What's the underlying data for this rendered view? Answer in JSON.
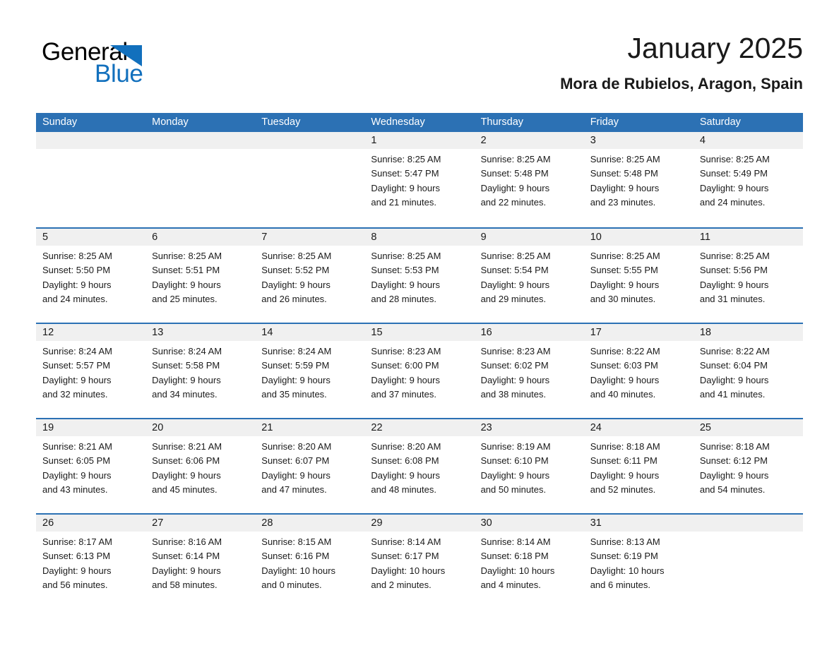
{
  "brand": {
    "name_part1": "General",
    "name_part2": "Blue",
    "logo_icon": "triangle-pennant-icon",
    "accent_color": "#1270bd"
  },
  "header": {
    "title": "January 2025",
    "location": "Mora de Rubielos, Aragon, Spain"
  },
  "theme": {
    "header_blue": "#2c71b4",
    "day_band_gray": "#f0f0f0",
    "text_color": "#1a1a1a",
    "page_background": "#ffffff"
  },
  "weekdays": [
    "Sunday",
    "Monday",
    "Tuesday",
    "Wednesday",
    "Thursday",
    "Friday",
    "Saturday"
  ],
  "weeks": [
    [
      {
        "day": "",
        "lines": []
      },
      {
        "day": "",
        "lines": []
      },
      {
        "day": "",
        "lines": []
      },
      {
        "day": "1",
        "lines": [
          "Sunrise: 8:25 AM",
          "Sunset: 5:47 PM",
          "Daylight: 9 hours",
          "and 21 minutes."
        ]
      },
      {
        "day": "2",
        "lines": [
          "Sunrise: 8:25 AM",
          "Sunset: 5:48 PM",
          "Daylight: 9 hours",
          "and 22 minutes."
        ]
      },
      {
        "day": "3",
        "lines": [
          "Sunrise: 8:25 AM",
          "Sunset: 5:48 PM",
          "Daylight: 9 hours",
          "and 23 minutes."
        ]
      },
      {
        "day": "4",
        "lines": [
          "Sunrise: 8:25 AM",
          "Sunset: 5:49 PM",
          "Daylight: 9 hours",
          "and 24 minutes."
        ]
      }
    ],
    [
      {
        "day": "5",
        "lines": [
          "Sunrise: 8:25 AM",
          "Sunset: 5:50 PM",
          "Daylight: 9 hours",
          "and 24 minutes."
        ]
      },
      {
        "day": "6",
        "lines": [
          "Sunrise: 8:25 AM",
          "Sunset: 5:51 PM",
          "Daylight: 9 hours",
          "and 25 minutes."
        ]
      },
      {
        "day": "7",
        "lines": [
          "Sunrise: 8:25 AM",
          "Sunset: 5:52 PM",
          "Daylight: 9 hours",
          "and 26 minutes."
        ]
      },
      {
        "day": "8",
        "lines": [
          "Sunrise: 8:25 AM",
          "Sunset: 5:53 PM",
          "Daylight: 9 hours",
          "and 28 minutes."
        ]
      },
      {
        "day": "9",
        "lines": [
          "Sunrise: 8:25 AM",
          "Sunset: 5:54 PM",
          "Daylight: 9 hours",
          "and 29 minutes."
        ]
      },
      {
        "day": "10",
        "lines": [
          "Sunrise: 8:25 AM",
          "Sunset: 5:55 PM",
          "Daylight: 9 hours",
          "and 30 minutes."
        ]
      },
      {
        "day": "11",
        "lines": [
          "Sunrise: 8:25 AM",
          "Sunset: 5:56 PM",
          "Daylight: 9 hours",
          "and 31 minutes."
        ]
      }
    ],
    [
      {
        "day": "12",
        "lines": [
          "Sunrise: 8:24 AM",
          "Sunset: 5:57 PM",
          "Daylight: 9 hours",
          "and 32 minutes."
        ]
      },
      {
        "day": "13",
        "lines": [
          "Sunrise: 8:24 AM",
          "Sunset: 5:58 PM",
          "Daylight: 9 hours",
          "and 34 minutes."
        ]
      },
      {
        "day": "14",
        "lines": [
          "Sunrise: 8:24 AM",
          "Sunset: 5:59 PM",
          "Daylight: 9 hours",
          "and 35 minutes."
        ]
      },
      {
        "day": "15",
        "lines": [
          "Sunrise: 8:23 AM",
          "Sunset: 6:00 PM",
          "Daylight: 9 hours",
          "and 37 minutes."
        ]
      },
      {
        "day": "16",
        "lines": [
          "Sunrise: 8:23 AM",
          "Sunset: 6:02 PM",
          "Daylight: 9 hours",
          "and 38 minutes."
        ]
      },
      {
        "day": "17",
        "lines": [
          "Sunrise: 8:22 AM",
          "Sunset: 6:03 PM",
          "Daylight: 9 hours",
          "and 40 minutes."
        ]
      },
      {
        "day": "18",
        "lines": [
          "Sunrise: 8:22 AM",
          "Sunset: 6:04 PM",
          "Daylight: 9 hours",
          "and 41 minutes."
        ]
      }
    ],
    [
      {
        "day": "19",
        "lines": [
          "Sunrise: 8:21 AM",
          "Sunset: 6:05 PM",
          "Daylight: 9 hours",
          "and 43 minutes."
        ]
      },
      {
        "day": "20",
        "lines": [
          "Sunrise: 8:21 AM",
          "Sunset: 6:06 PM",
          "Daylight: 9 hours",
          "and 45 minutes."
        ]
      },
      {
        "day": "21",
        "lines": [
          "Sunrise: 8:20 AM",
          "Sunset: 6:07 PM",
          "Daylight: 9 hours",
          "and 47 minutes."
        ]
      },
      {
        "day": "22",
        "lines": [
          "Sunrise: 8:20 AM",
          "Sunset: 6:08 PM",
          "Daylight: 9 hours",
          "and 48 minutes."
        ]
      },
      {
        "day": "23",
        "lines": [
          "Sunrise: 8:19 AM",
          "Sunset: 6:10 PM",
          "Daylight: 9 hours",
          "and 50 minutes."
        ]
      },
      {
        "day": "24",
        "lines": [
          "Sunrise: 8:18 AM",
          "Sunset: 6:11 PM",
          "Daylight: 9 hours",
          "and 52 minutes."
        ]
      },
      {
        "day": "25",
        "lines": [
          "Sunrise: 8:18 AM",
          "Sunset: 6:12 PM",
          "Daylight: 9 hours",
          "and 54 minutes."
        ]
      }
    ],
    [
      {
        "day": "26",
        "lines": [
          "Sunrise: 8:17 AM",
          "Sunset: 6:13 PM",
          "Daylight: 9 hours",
          "and 56 minutes."
        ]
      },
      {
        "day": "27",
        "lines": [
          "Sunrise: 8:16 AM",
          "Sunset: 6:14 PM",
          "Daylight: 9 hours",
          "and 58 minutes."
        ]
      },
      {
        "day": "28",
        "lines": [
          "Sunrise: 8:15 AM",
          "Sunset: 6:16 PM",
          "Daylight: 10 hours",
          "and 0 minutes."
        ]
      },
      {
        "day": "29",
        "lines": [
          "Sunrise: 8:14 AM",
          "Sunset: 6:17 PM",
          "Daylight: 10 hours",
          "and 2 minutes."
        ]
      },
      {
        "day": "30",
        "lines": [
          "Sunrise: 8:14 AM",
          "Sunset: 6:18 PM",
          "Daylight: 10 hours",
          "and 4 minutes."
        ]
      },
      {
        "day": "31",
        "lines": [
          "Sunrise: 8:13 AM",
          "Sunset: 6:19 PM",
          "Daylight: 10 hours",
          "and 6 minutes."
        ]
      },
      {
        "day": "",
        "lines": []
      }
    ]
  ]
}
